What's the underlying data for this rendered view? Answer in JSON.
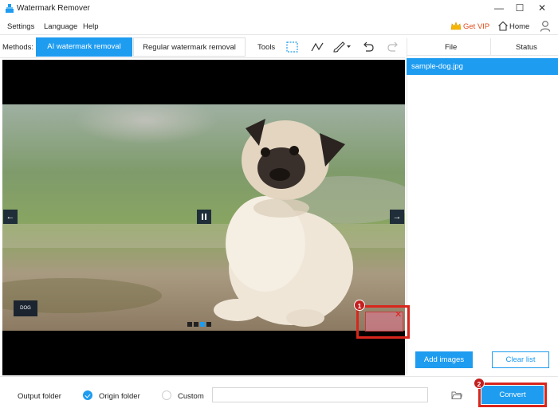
{
  "window": {
    "title": "Watermark Remover",
    "minimize": "—",
    "maximize": "☐",
    "close": "✕"
  },
  "menu": {
    "settings": "Settings",
    "language": "Language",
    "help": "Help",
    "get_vip": "Get VIP",
    "home": "Home"
  },
  "methods": {
    "label": "Methods:",
    "ai": "AI watermark removal",
    "regular": "Regular watermark removal",
    "tools_label": "Tools",
    "tool_icons": [
      "rectangle-select-icon",
      "lasso-icon",
      "brush-icon",
      "undo-icon",
      "redo-icon"
    ]
  },
  "file_list": {
    "col_file": "File",
    "col_status": "Status",
    "files": [
      {
        "name": "sample-dog.jpg",
        "status": ""
      }
    ],
    "add_images": "Add images",
    "clear_list": "Clear list"
  },
  "preview": {
    "prev": "←",
    "next": "→",
    "watermark_text": "DOG"
  },
  "annotations": {
    "badge1": "1",
    "badge2": "2"
  },
  "output": {
    "label": "Output folder",
    "origin": "Origin folder",
    "custom": "Custom",
    "path_value": "",
    "convert": "Convert"
  },
  "colors": {
    "accent": "#1e9cf0",
    "highlight": "#d9261c",
    "vip": "#e04b1a"
  }
}
